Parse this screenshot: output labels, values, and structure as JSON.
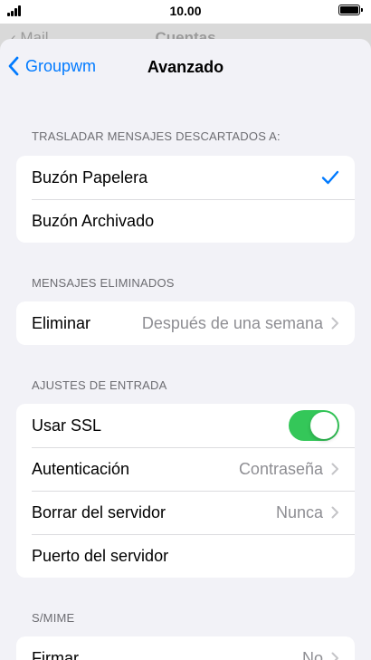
{
  "status": {
    "time": "10.00"
  },
  "background_nav": {
    "back_label": "Mail",
    "title": "Cuentas"
  },
  "nav": {
    "back_label": "Groupwm",
    "title": "Avanzado"
  },
  "sections": {
    "move_discarded": {
      "header": "TRASLADAR MENSAJES DESCARTADOS A:",
      "rows": [
        {
          "label": "Buzón Papelera",
          "selected": true
        },
        {
          "label": "Buzón Archivado",
          "selected": false
        }
      ]
    },
    "deleted": {
      "header": "MENSAJES ELIMINADOS",
      "rows": [
        {
          "label": "Eliminar",
          "value": "Después de una semana"
        }
      ]
    },
    "incoming": {
      "header": "AJUSTES DE ENTRADA",
      "rows": [
        {
          "label": "Usar SSL",
          "toggle": true
        },
        {
          "label": "Autenticación",
          "value": "Contraseña"
        },
        {
          "label": "Borrar del servidor",
          "value": "Nunca"
        },
        {
          "label": "Puerto del servidor",
          "value": ""
        }
      ]
    },
    "smime": {
      "header": "S/MIME",
      "rows": [
        {
          "label": "Firmar",
          "value": "No"
        }
      ]
    }
  },
  "colors": {
    "accent": "#007aff",
    "toggle_on": "#34c759",
    "background": "#f2f2f7"
  },
  "icons": {
    "back": "chevron-left-icon",
    "disclosure": "chevron-right-icon",
    "selected": "checkmark-icon"
  }
}
